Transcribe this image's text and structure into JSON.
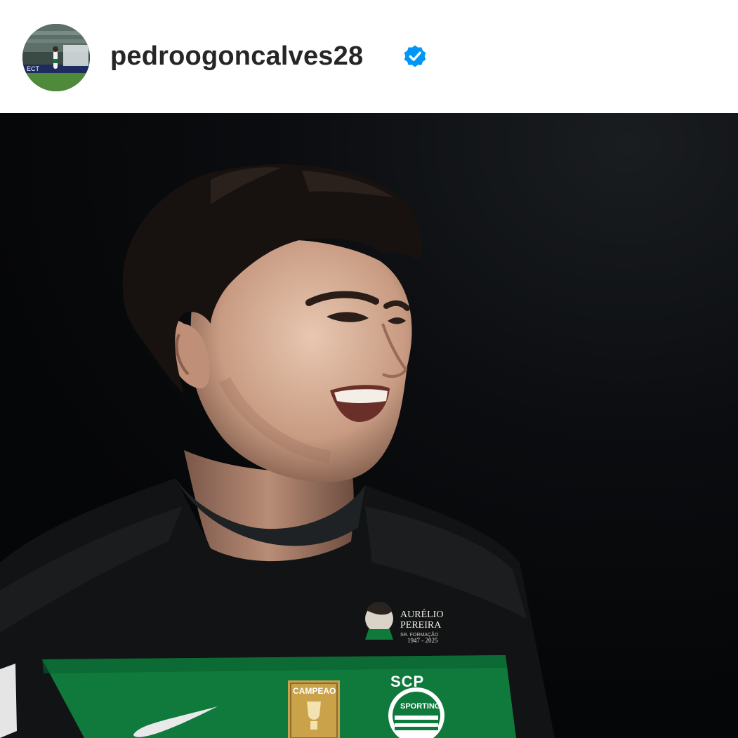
{
  "post": {
    "author": {
      "username": "pedroogoncalves28",
      "verified": true,
      "avatar_icon": "profile-avatar"
    },
    "image": {
      "kit_badge_text": "CAMPEAO",
      "club_short": "SCP",
      "club_name": "SPORTING",
      "tribute_name_line1": "AURÉLIO",
      "tribute_name_line2": "PEREIRA",
      "tribute_subtitle": "SR. FORMAÇÃO",
      "tribute_years": "1947 - 2025",
      "avatar_banner_text": "ECT"
    }
  },
  "colors": {
    "verified_badge": "#0095f6",
    "username_text": "#262626",
    "kit_green": "#0f7a3c",
    "kit_black": "#0d0f10",
    "badge_gold": "#c9a24a"
  }
}
